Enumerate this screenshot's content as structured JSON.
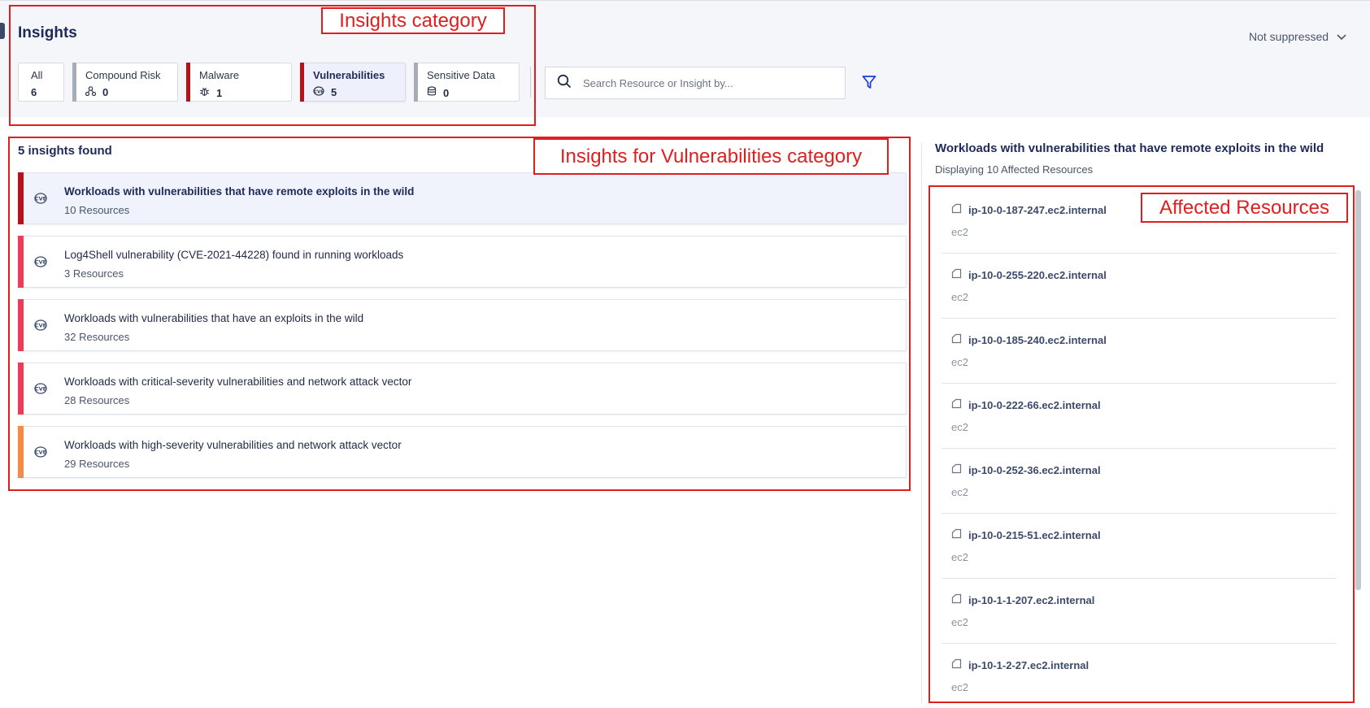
{
  "page": {
    "title": "Insights"
  },
  "header": {
    "suppress_filter": "Not suppressed"
  },
  "categories": [
    {
      "label": "All",
      "count": "6",
      "icon": "",
      "color": ""
    },
    {
      "label": "Compound Risk",
      "count": "0",
      "icon": "compound-risk-icon",
      "color": "#a7adb8"
    },
    {
      "label": "Malware",
      "count": "1",
      "icon": "bug-icon",
      "color": "#b5121b"
    },
    {
      "label": "Vulnerabilities",
      "count": "5",
      "icon": "cve-icon",
      "color": "#b5121b"
    },
    {
      "label": "Sensitive Data",
      "count": "0",
      "icon": "database-icon",
      "color": "#a7adb8"
    }
  ],
  "search": {
    "placeholder": "Search Resource or Insight by..."
  },
  "insights": {
    "found_label": "5 insights found",
    "items": [
      {
        "title": "Workloads with vulnerabilities that have remote exploits in the wild",
        "resources": "10 Resources",
        "severity_color": "#b5121b"
      },
      {
        "title": "Log4Shell vulnerability (CVE-2021-44228) found in running workloads",
        "resources": "3 Resources",
        "severity_color": "#ef3b5a"
      },
      {
        "title": "Workloads with vulnerabilities that have an exploits in the wild",
        "resources": "32 Resources",
        "severity_color": "#ef3b5a"
      },
      {
        "title": "Workloads with critical-severity vulnerabilities and network attack vector",
        "resources": "28 Resources",
        "severity_color": "#ef3b5a"
      },
      {
        "title": "Workloads with high-severity vulnerabilities and network attack vector",
        "resources": "29 Resources",
        "severity_color": "#f58a42"
      }
    ]
  },
  "detail": {
    "title": "Workloads with vulnerabilities that have remote exploits in the wild",
    "subtitle": "Displaying 10 Affected Resources",
    "resources": [
      {
        "name": "ip-10-0-187-247.ec2.internal",
        "type": "ec2"
      },
      {
        "name": "ip-10-0-255-220.ec2.internal",
        "type": "ec2"
      },
      {
        "name": "ip-10-0-185-240.ec2.internal",
        "type": "ec2"
      },
      {
        "name": "ip-10-0-222-66.ec2.internal",
        "type": "ec2"
      },
      {
        "name": "ip-10-0-252-36.ec2.internal",
        "type": "ec2"
      },
      {
        "name": "ip-10-0-215-51.ec2.internal",
        "type": "ec2"
      },
      {
        "name": "ip-10-1-1-207.ec2.internal",
        "type": "ec2"
      },
      {
        "name": "ip-10-1-2-27.ec2.internal",
        "type": "ec2"
      }
    ]
  },
  "annotations": {
    "insights_category": "Insights category",
    "insights_for_vulnerabilities": "Insights for Vulnerabilities category",
    "affected_resources": "Affected Resources"
  }
}
